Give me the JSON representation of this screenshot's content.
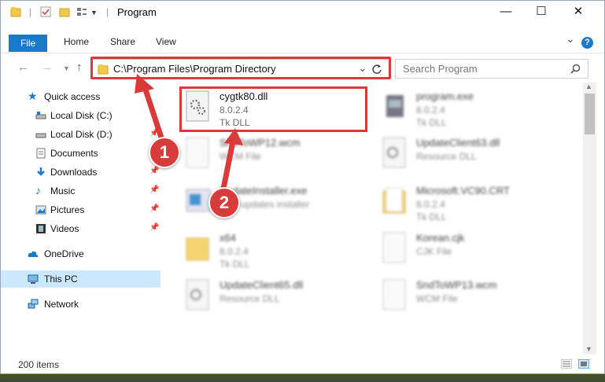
{
  "window": {
    "title": "Program",
    "controls": {
      "minimize": "—",
      "maximize": "☐",
      "close": "✕"
    }
  },
  "ribbon": {
    "tabs": [
      "File",
      "Home",
      "Share",
      "View"
    ],
    "expand": "⌄",
    "help": "?"
  },
  "address": {
    "path": "C:\\Program Files\\Program Directory",
    "dropdown": "⌄",
    "search_placeholder": "Search Program"
  },
  "sidebar": {
    "quick_access": "Quick access",
    "items": [
      {
        "label": "Local Disk (C:)"
      },
      {
        "label": "Local Disk (D:)"
      },
      {
        "label": "Documents"
      },
      {
        "label": "Downloads"
      },
      {
        "label": "Music"
      },
      {
        "label": "Pictures"
      },
      {
        "label": "Videos"
      }
    ],
    "onedrive": "OneDrive",
    "this_pc": "This PC",
    "network": "Network"
  },
  "files": [
    {
      "name": "cygtk80.dll",
      "line2": "8.0.2.4",
      "line3": "Tk DLL",
      "icon": "gear-file-icon"
    },
    {
      "name": "program.exe",
      "line2": "8.0.2.4",
      "line3": "Tk DLL",
      "icon": "app-icon"
    },
    {
      "name": "SndToWP12.wcm",
      "line2": "WCM File",
      "line3": "",
      "icon": "blank-file-icon"
    },
    {
      "name": "UpdateClient63.dll",
      "line2": "Resource DLL",
      "line3": "",
      "icon": "gear-file-icon"
    },
    {
      "name": "UpdateInstaller.exe",
      "line2": "DAY updates installer",
      "line3": "",
      "icon": "installer-icon"
    },
    {
      "name": "Microsoft.VC90.CRT",
      "line2": "8.0.2.4",
      "line3": "Tk DLL",
      "icon": "folder-icon"
    },
    {
      "name": "x64",
      "line2": "8.0.2.4",
      "line3": "Tk DLL",
      "icon": "folder-icon"
    },
    {
      "name": "Korean.cjk",
      "line2": "CJK File",
      "line3": "",
      "icon": "blank-file-icon"
    },
    {
      "name": "UpdateClient65.dll",
      "line2": "Resource DLL",
      "line3": "",
      "icon": "gear-file-icon"
    },
    {
      "name": "SndToWP13.wcm",
      "line2": "WCM File",
      "line3": "",
      "icon": "blank-file-icon"
    }
  ],
  "status": {
    "count": "200 items"
  },
  "callouts": [
    "1",
    "2"
  ],
  "colors": {
    "accent": "#1979ca",
    "highlight": "#d93a3a",
    "selection": "#cce8ff"
  }
}
